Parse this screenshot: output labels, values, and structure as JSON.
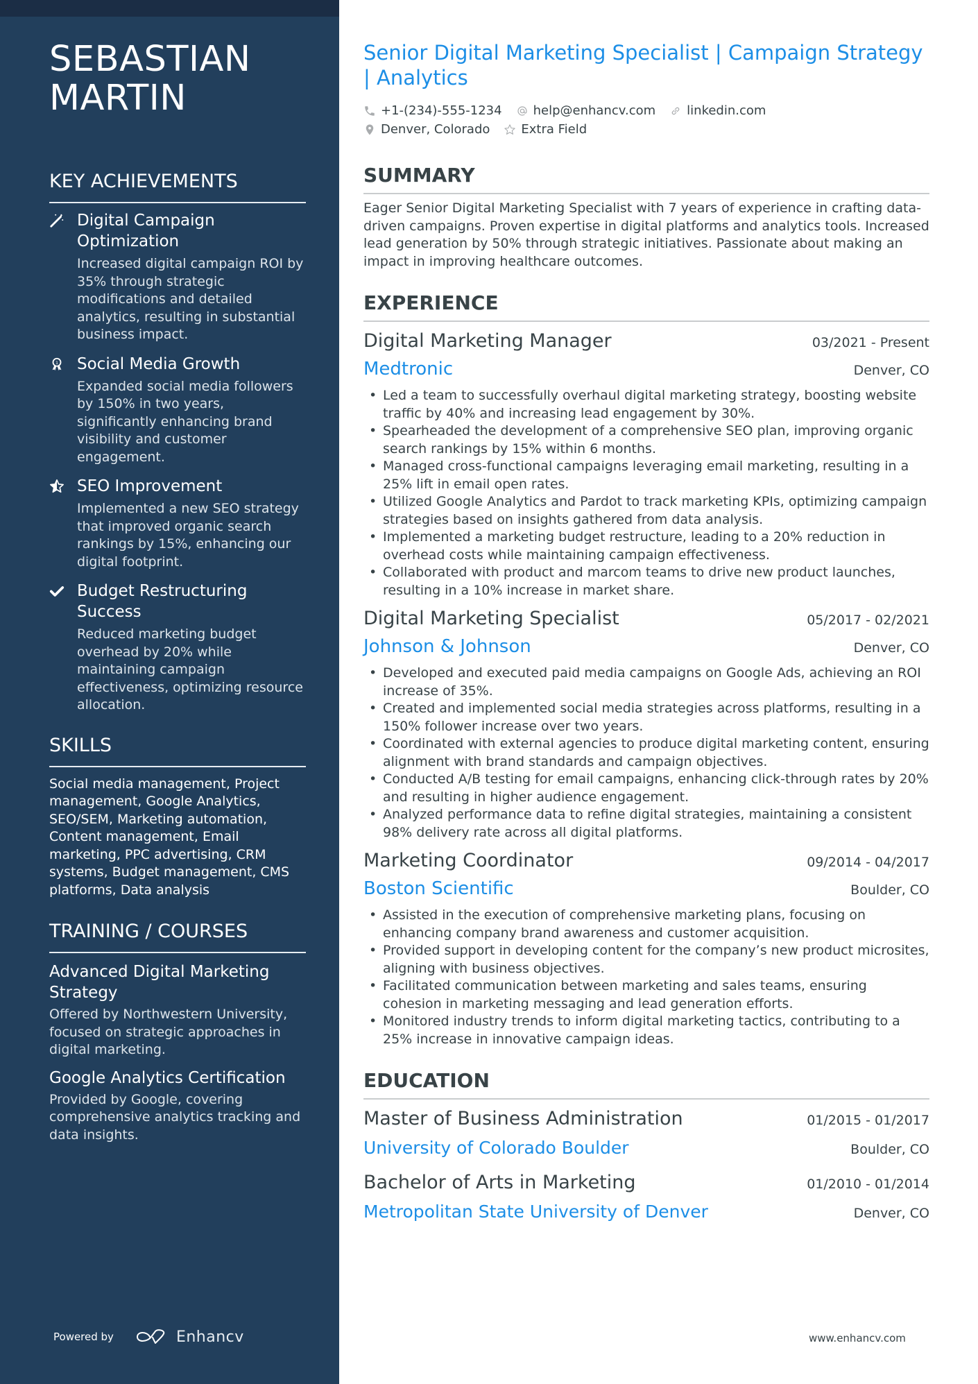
{
  "sidebar": {
    "name": "SEBASTIAN MARTIN",
    "name_line1": "SEBASTIAN",
    "name_line2": "MARTIN",
    "achievements_heading": "KEY ACHIEVEMENTS",
    "achievements": [
      {
        "icon": "magic-wand-icon",
        "title": "Digital Campaign Optimization",
        "description": "Increased digital campaign ROI by 35% through strategic modifications and detailed analytics, resulting in substantial business impact."
      },
      {
        "icon": "award-ribbon-icon",
        "title": "Social Media Growth",
        "description": "Expanded social media followers by 150% in two years, significantly enhancing brand visibility and customer engagement."
      },
      {
        "icon": "half-star-icon",
        "title": "SEO Improvement",
        "description": "Implemented a new SEO strategy that improved organic search rankings by 15%, enhancing our digital footprint."
      },
      {
        "icon": "checkmark-icon",
        "title": "Budget Restructuring Success",
        "description": "Reduced marketing budget overhead by 20% while maintaining campaign effectiveness, optimizing resource allocation."
      }
    ],
    "skills_heading": "SKILLS",
    "skills_text": "Social media management, Project management, Google Analytics, SEO/SEM, Marketing automation, Content management, Email marketing, PPC advertising, CRM systems, Budget management, CMS platforms, Data analysis",
    "training_heading": "TRAINING / COURSES",
    "courses": [
      {
        "title": "Advanced Digital Marketing Strategy",
        "description": "Offered by Northwestern University, focused on strategic approaches in digital marketing."
      },
      {
        "title": "Google Analytics Certification",
        "description": "Provided by Google, covering comprehensive analytics tracking and data insights."
      }
    ],
    "powered_by": "Powered by",
    "brand": "Enhancv"
  },
  "header": {
    "headline": "Senior Digital Marketing Specialist | Campaign Strategy | Analytics",
    "contacts": {
      "phone": "+1-(234)-555-1234",
      "email": "help@enhancv.com",
      "link": "linkedin.com",
      "location": "Denver, Colorado",
      "extra": "Extra Field"
    }
  },
  "summary": {
    "heading": "SUMMARY",
    "text": "Eager Senior Digital Marketing Specialist with 7 years of experience in crafting data-driven campaigns. Proven expertise in digital platforms and analytics tools. Increased lead generation by 50% through strategic initiatives. Passionate about making an impact in improving healthcare outcomes."
  },
  "experience": {
    "heading": "EXPERIENCE",
    "jobs": [
      {
        "title": "Digital Marketing Manager",
        "dates": "03/2021 - Present",
        "company": "Medtronic",
        "location": "Denver, CO",
        "bullets": [
          "Led a team to successfully overhaul digital marketing strategy, boosting website traffic by 40% and increasing lead engagement by 30%.",
          "Spearheaded the development of a comprehensive SEO plan, improving organic search rankings by 15% within 6 months.",
          "Managed cross-functional campaigns leveraging email marketing, resulting in a 25% lift in email open rates.",
          "Utilized Google Analytics and Pardot to track marketing KPIs, optimizing campaign strategies based on insights gathered from data analysis.",
          "Implemented a marketing budget restructure, leading to a 20% reduction in overhead costs while maintaining campaign effectiveness.",
          "Collaborated with product and marcom teams to drive new product launches, resulting in a 10% increase in market share."
        ]
      },
      {
        "title": "Digital Marketing Specialist",
        "dates": "05/2017 - 02/2021",
        "company": "Johnson & Johnson",
        "location": "Denver, CO",
        "bullets": [
          "Developed and executed paid media campaigns on Google Ads, achieving an ROI increase of 35%.",
          "Created and implemented social media strategies across platforms, resulting in a 150% follower increase over two years.",
          "Coordinated with external agencies to produce digital marketing content, ensuring alignment with brand standards and campaign objectives.",
          "Conducted A/B testing for email campaigns, enhancing click-through rates by 20% and resulting in higher audience engagement.",
          "Analyzed performance data to refine digital strategies, maintaining a consistent 98% delivery rate across all digital platforms."
        ]
      },
      {
        "title": "Marketing Coordinator",
        "dates": "09/2014 - 04/2017",
        "company": "Boston Scientific",
        "location": "Boulder, CO",
        "bullets": [
          "Assisted in the execution of comprehensive marketing plans, focusing on enhancing company brand awareness and customer acquisition.",
          "Provided support in developing content for the company’s new product microsites, aligning with business objectives.",
          "Facilitated communication between marketing and sales teams, ensuring cohesion in marketing messaging and lead generation efforts.",
          "Monitored industry trends to inform digital marketing tactics, contributing to a 25% increase in innovative campaign ideas."
        ]
      }
    ]
  },
  "education": {
    "heading": "EDUCATION",
    "items": [
      {
        "degree": "Master of Business Administration",
        "dates": "01/2015 - 01/2017",
        "school": "University of Colorado Boulder",
        "location": "Boulder, CO"
      },
      {
        "degree": "Bachelor of Arts in Marketing",
        "dates": "01/2010 - 01/2014",
        "school": "Metropolitan State University of Denver",
        "location": "Denver, CO"
      }
    ]
  },
  "footer": {
    "url": "www.enhancv.com"
  },
  "colors": {
    "sidebar_bg": "#223f5c",
    "sidebar_topbar": "#1b2d45",
    "accent": "#1c8ee6",
    "text": "#384347"
  }
}
